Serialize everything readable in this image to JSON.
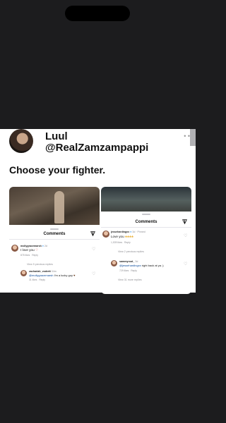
{
  "tweet": {
    "display_name": "Luul",
    "handle": "@RealZamzampappi",
    "text": "Choose your fighter."
  },
  "left_panel": {
    "sheet_title": "Comments",
    "comment": {
      "user": "mollygracemarsh",
      "age": "2d",
      "text": "I love you",
      "likes": "878 likes",
      "reply": "Reply"
    },
    "view_replies": "View 5 previous replies",
    "reply": {
      "user": "zachariah_vodrett",
      "age": "34m",
      "mention": "@mollygracemarsh",
      "text": " I'm a lucky guy",
      "likes": "31 likes",
      "reply": "Reply"
    }
  },
  "right_panel": {
    "sheet_title": "Comments",
    "comment": {
      "user": "jessehardingxx",
      "age": "3d",
      "pinned": "· Pinned",
      "text": "Love you",
      "likes": "1,539 likes",
      "reply": "Reply"
    },
    "view_previous": "View 2 previous replies",
    "reply": {
      "user": "sammyroot_",
      "age": "3d",
      "mention": "@jessehardingxx",
      "text": " right back at ya ;)",
      "likes": "729 likes",
      "reply": "Reply"
    },
    "view_more": "View 31 more replies"
  },
  "colors": {
    "background": "#1c1c1e",
    "card": "#ffffff",
    "mention": "#0a4a9b",
    "verified": "#3897f0"
  },
  "icons": [
    "filter-icon",
    "heart-icon",
    "verified-icon",
    "more-icon"
  ]
}
